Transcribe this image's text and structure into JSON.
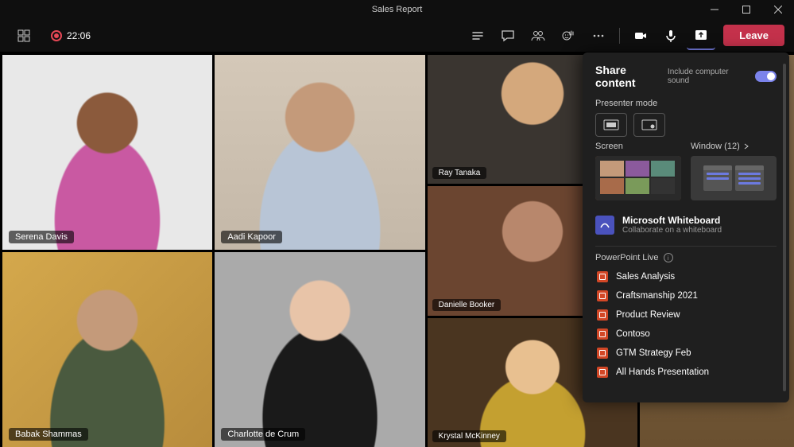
{
  "window": {
    "title": "Sales Report"
  },
  "meeting": {
    "duration": "22:06"
  },
  "toolbar": {
    "leave": "Leave"
  },
  "participants": {
    "large": [
      {
        "name": "Serena Davis"
      },
      {
        "name": "Aadi Kapoor"
      },
      {
        "name": "Babak Shammas"
      },
      {
        "name": "Charlotte de Crum"
      }
    ],
    "small": [
      {
        "name": "Ray Tanaka"
      },
      {
        "name": "Danielle Booker"
      },
      {
        "name": "Krystal McKinney"
      }
    ]
  },
  "share": {
    "title": "Share content",
    "include_sound": "Include computer sound",
    "presenter_label": "Presenter mode",
    "screen_label": "Screen",
    "window_label": "Window (12)",
    "whiteboard": {
      "title": "Microsoft Whiteboard",
      "sub": "Collaborate on a whiteboard"
    },
    "ppt_label": "PowerPoint Live",
    "ppt_items": [
      "Sales Analysis",
      "Craftsmanship 2021",
      "Product Review",
      "Contoso",
      "GTM Strategy Feb",
      "All Hands Presentation"
    ]
  }
}
